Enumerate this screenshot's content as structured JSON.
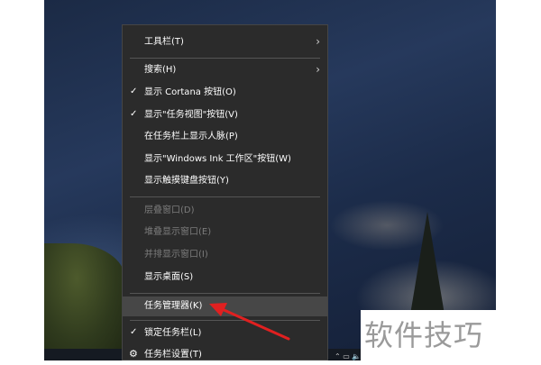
{
  "context_menu": {
    "items": [
      {
        "label": "工具栏(T)",
        "checked": false,
        "submenu": true
      },
      {
        "label": "搜索(H)",
        "checked": false,
        "submenu": true
      },
      {
        "label": "显示 Cortana 按钮(O)",
        "checked": true
      },
      {
        "label": "显示\"任务视图\"按钮(V)",
        "checked": true
      },
      {
        "label": "在任务栏上显示人脉(P)",
        "checked": false
      },
      {
        "label": "显示\"Windows Ink 工作区\"按钮(W)",
        "checked": false
      },
      {
        "label": "显示触摸键盘按钮(Y)",
        "checked": false
      },
      {
        "label": "层叠窗口(D)",
        "disabled": true
      },
      {
        "label": "堆叠显示窗口(E)",
        "disabled": true
      },
      {
        "label": "并排显示窗口(I)",
        "disabled": true
      },
      {
        "label": "显示桌面(S)",
        "disabled": false
      },
      {
        "label": "任务管理器(K)",
        "highlighted": true
      },
      {
        "label": "锁定任务栏(L)",
        "checked": true
      },
      {
        "label": "任务栏设置(T)",
        "icon": "gear-icon"
      }
    ]
  },
  "annotation": {
    "arrow_color": "#e02020"
  },
  "watermark": {
    "text": "软件技巧"
  },
  "colors": {
    "menu_bg": "#2b2b2b",
    "highlight_bg": "#474747",
    "disabled_text": "#7c7c7c"
  }
}
